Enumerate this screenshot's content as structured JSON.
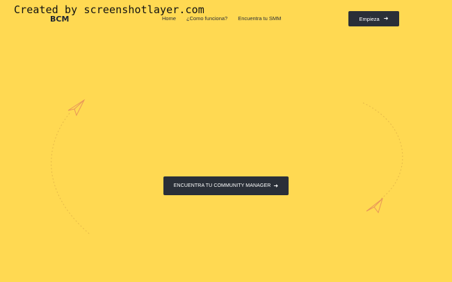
{
  "watermark": "Created by screenshotlayer.com",
  "header": {
    "logo": "BCM",
    "nav": [
      {
        "label": "Home"
      },
      {
        "label": "¿Como funciona?"
      },
      {
        "label": "Encuentra tu SMM"
      }
    ],
    "cta_label": "Empieza"
  },
  "hero": {
    "cta_label": "ENCUENTRA TU COMMUNITY MANAGER"
  },
  "icons": {
    "arrow": "arrow-right-icon",
    "plane": "paper-plane-icon"
  },
  "colors": {
    "background": "#FFD952",
    "button": "#2a2f38",
    "plane": "#e8955a"
  }
}
